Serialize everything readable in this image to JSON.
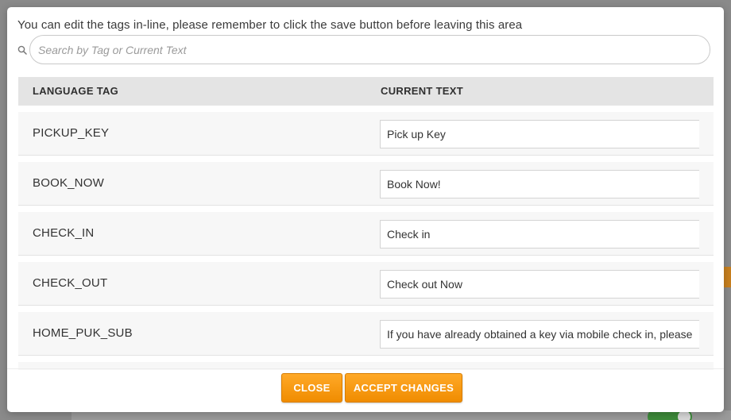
{
  "modal": {
    "intro_text": "You can edit the tags in-line, please remember to click the save button before leaving this area",
    "search": {
      "placeholder": "Search by Tag or Current Text",
      "value": ""
    },
    "table": {
      "columns": [
        "LANGUAGE TAG",
        "CURRENT TEXT"
      ],
      "rows": [
        {
          "tag": "PICKUP_KEY",
          "text": "Pick up Key"
        },
        {
          "tag": "BOOK_NOW",
          "text": "Book Now!"
        },
        {
          "tag": "CHECK_IN",
          "text": "Check in"
        },
        {
          "tag": "CHECK_OUT",
          "text": "Check out Now"
        },
        {
          "tag": "HOME_PUK_SUB",
          "text": "If you have already obtained a key via mobile check in, please se"
        }
      ]
    },
    "buttons": {
      "close_label": "CLOSE",
      "accept_label": "ACCEPT CHANGES"
    }
  },
  "colors": {
    "accent": "#f5a018",
    "header_bg": "#e4e4e4",
    "backdrop": "#8a8a8a",
    "toggle_on": "#3d8a3a"
  },
  "icons": {
    "search": "search-icon"
  }
}
